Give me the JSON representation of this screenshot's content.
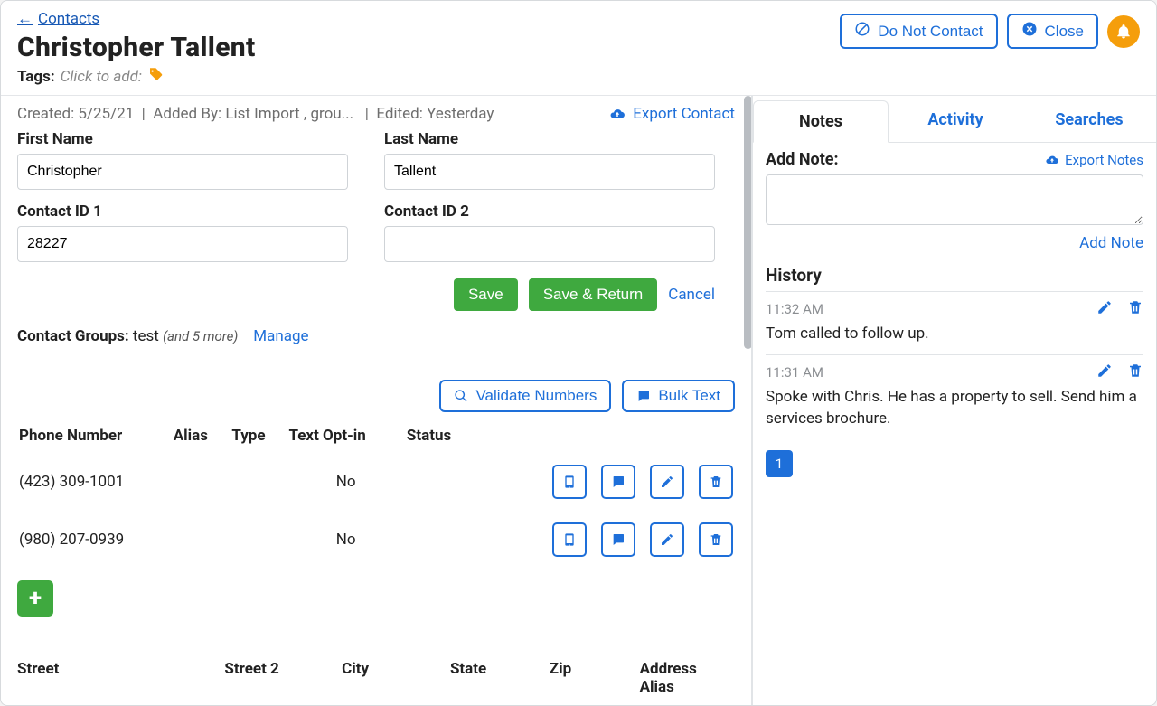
{
  "header": {
    "back_link": "Contacts",
    "contact_name": "Christopher Tallent",
    "tags_label": "Tags:",
    "tags_placeholder": "Click to add:",
    "do_not_contact": "Do Not Contact",
    "close": "Close"
  },
  "meta": {
    "created_label": "Created: 5/25/21",
    "added_by": "Added By: List Import , grou...",
    "edited": "Edited: Yesterday",
    "export": "Export Contact"
  },
  "form": {
    "first_name_label": "First Name",
    "first_name_value": "Christopher",
    "last_name_label": "Last Name",
    "last_name_value": "Tallent",
    "contact_id1_label": "Contact ID 1",
    "contact_id1_value": "28227",
    "contact_id2_label": "Contact ID 2",
    "contact_id2_value": "",
    "save": "Save",
    "save_return": "Save & Return",
    "cancel": "Cancel"
  },
  "groups": {
    "label": "Contact Groups:",
    "value": "test",
    "more": "(and 5 more)",
    "manage": "Manage"
  },
  "phone_section": {
    "validate": "Validate Numbers",
    "bulk_text": "Bulk Text",
    "headers": {
      "number": "Phone Number",
      "alias": "Alias",
      "type": "Type",
      "optin": "Text Opt-in",
      "status": "Status"
    },
    "rows": [
      {
        "number": "(423) 309-1001",
        "alias": "",
        "type": "",
        "optin": "No",
        "status": ""
      },
      {
        "number": "(980) 207-0939",
        "alias": "",
        "type": "",
        "optin": "No",
        "status": ""
      }
    ]
  },
  "address_headers": {
    "street": "Street",
    "street2": "Street 2",
    "city": "City",
    "state": "State",
    "zip": "Zip",
    "alias": "Address Alias"
  },
  "tabs": {
    "notes": "Notes",
    "activity": "Activity",
    "searches": "Searches"
  },
  "notes": {
    "add_label": "Add Note:",
    "export": "Export Notes",
    "add_link": "Add Note",
    "history": "History",
    "items": [
      {
        "time": "11:32 AM",
        "text": "Tom called to follow up."
      },
      {
        "time": "11:31 AM",
        "text": "Spoke with Chris. He has a property to sell. Send him a services brochure."
      }
    ],
    "page": "1"
  }
}
